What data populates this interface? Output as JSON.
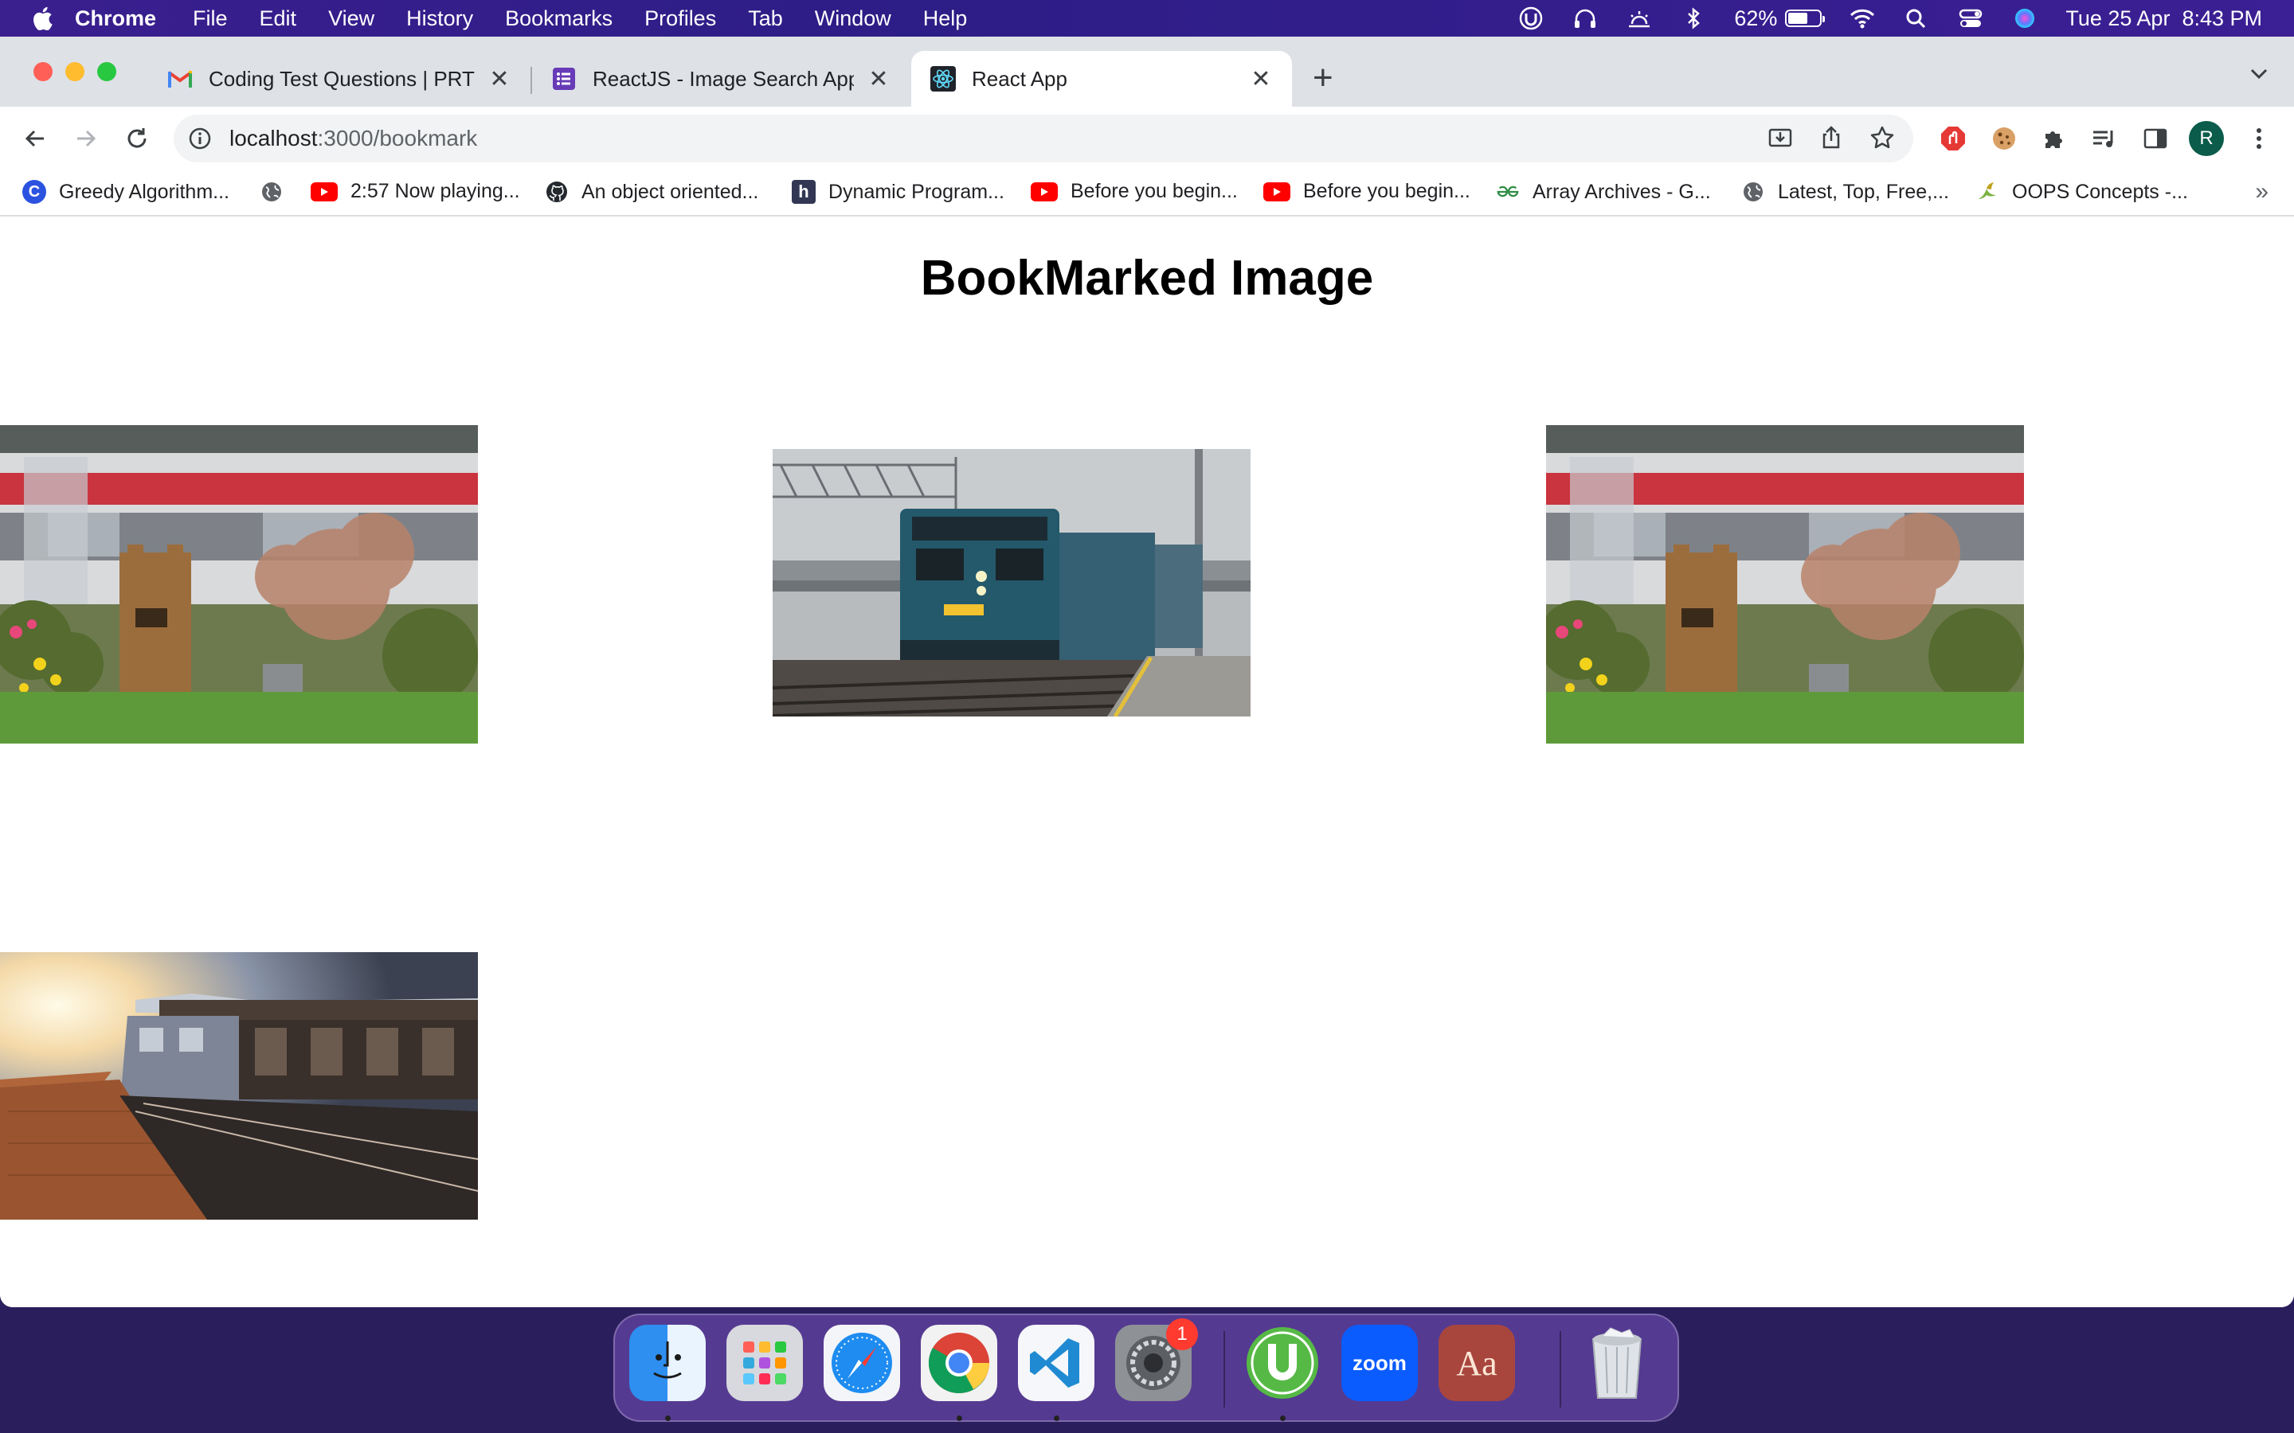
{
  "menubar": {
    "app_name": "Chrome",
    "items": [
      "File",
      "Edit",
      "View",
      "History",
      "Bookmarks",
      "Profiles",
      "Tab",
      "Window",
      "Help"
    ],
    "battery_percent": "62%",
    "battery_level": 0.62,
    "datetime": "Tue 25 Apr  8:43 PM"
  },
  "browser": {
    "tabs": [
      {
        "title": "Coding Test Questions | PRT Te",
        "icon": "gmail-icon",
        "active": false
      },
      {
        "title": "ReactJS - Image Search App",
        "icon": "forms-icon",
        "active": false
      },
      {
        "title": "React App",
        "icon": "react-icon",
        "active": true
      }
    ],
    "url_host": "localhost",
    "url_path": ":3000/bookmark",
    "profile_initial": "R",
    "bookmarks": [
      {
        "label": "Greedy Algorithm...",
        "icon": "coding-ninjas-icon"
      },
      {
        "label": "",
        "icon": "globe-icon"
      },
      {
        "label": "2:57 Now playing...",
        "icon": "youtube-icon"
      },
      {
        "label": "An object oriented...",
        "icon": "github-icon"
      },
      {
        "label": "Dynamic Program...",
        "icon": "hackerearth-icon"
      },
      {
        "label": "Before you begin...",
        "icon": "youtube-icon"
      },
      {
        "label": "Before you begin...",
        "icon": "youtube-icon"
      },
      {
        "label": "Array Archives - G...",
        "icon": "geeksforgeeks-icon"
      },
      {
        "label": "Latest, Top, Free,...",
        "icon": "globe-icon"
      },
      {
        "label": "OOPS Concepts -...",
        "icon": "bird-icon"
      }
    ],
    "bookmarks_overflow": "»"
  },
  "page": {
    "heading": "BookMarked Image",
    "images": [
      {
        "name": "garden-train-image"
      },
      {
        "name": "via-rail-locomotive-image"
      },
      {
        "name": "garden-train-image"
      },
      {
        "name": "sunset-platform-train-image"
      }
    ]
  },
  "dock": {
    "apps": [
      "Finder",
      "Launchpad",
      "Safari",
      "Google Chrome",
      "Visual Studio Code",
      "System Settings",
      "uTorrent",
      "Zoom",
      "Dictionary",
      "Trash"
    ],
    "settings_badge": "1",
    "zoom_label": "zoom",
    "dictionary_label": "Aa"
  }
}
